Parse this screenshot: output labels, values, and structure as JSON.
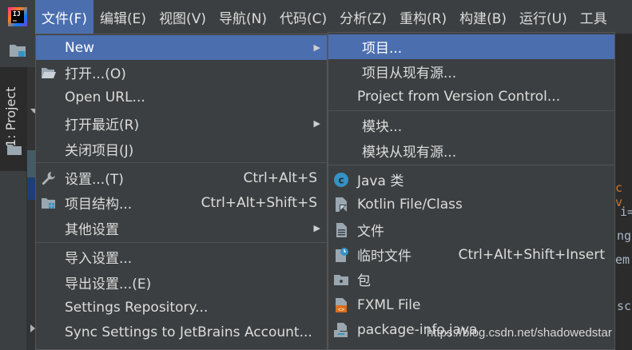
{
  "menubar": {
    "items": [
      {
        "label": "文件(F)",
        "active": true
      },
      {
        "label": "编辑(E)"
      },
      {
        "label": "视图(V)"
      },
      {
        "label": "导航(N)"
      },
      {
        "label": "代码(C)"
      },
      {
        "label": "分析(Z)"
      },
      {
        "label": "重构(R)"
      },
      {
        "label": "构建(B)"
      },
      {
        "label": "运行(U)"
      },
      {
        "label": "工具"
      }
    ]
  },
  "tool_window": {
    "project_label": "1: Project"
  },
  "editor": {
    "fragments": [
      "c v",
      "i=",
      "ng",
      "em.",
      "sc"
    ]
  },
  "file_menu": {
    "items": [
      {
        "label": "New",
        "icon": "none",
        "submenu": true
      },
      {
        "label": "打开...(O)",
        "icon": "folder-open-icon"
      },
      {
        "label": "Open URL..."
      },
      {
        "label": "打开最近(R)",
        "submenu": true
      },
      {
        "label": "关闭项目(J)"
      },
      {
        "label": "设置...(T)",
        "icon": "wrench-icon",
        "shortcut": "Ctrl+Alt+S"
      },
      {
        "label": "项目结构...",
        "icon": "project-structure-icon",
        "shortcut": "Ctrl+Alt+Shift+S"
      },
      {
        "label": "其他设置",
        "submenu": true
      },
      {
        "label": "导入设置..."
      },
      {
        "label": "导出设置...(E)"
      },
      {
        "label": "Settings Repository..."
      },
      {
        "label": "Sync Settings to JetBrains Account..."
      }
    ]
  },
  "new_submenu": {
    "items": [
      {
        "label": "项目..."
      },
      {
        "label": "项目从现有源..."
      },
      {
        "label": "Project from Version Control..."
      },
      {
        "label": "模块..."
      },
      {
        "label": "模块从现有源..."
      },
      {
        "label": "Java 类",
        "icon": "java-class-icon"
      },
      {
        "label": "Kotlin File/Class",
        "icon": "kotlin-file-icon"
      },
      {
        "label": "文件",
        "icon": "file-icon"
      },
      {
        "label": "临时文件",
        "icon": "scratch-file-icon",
        "shortcut": "Ctrl+Alt+Shift+Insert"
      },
      {
        "label": "包",
        "icon": "package-icon"
      },
      {
        "label": "FXML File",
        "icon": "fxml-file-icon"
      },
      {
        "label": "package-info.java",
        "icon": "package-info-icon"
      }
    ]
  },
  "watermark": "https://blog.csdn.net/shadowedstar",
  "colors": {
    "selection": "#4b6eaf",
    "menu_bg": "#3c3f41",
    "editor_bg": "#2b2b2b",
    "java_icon": "#3592c4",
    "fxml_icon": "#d9701f"
  }
}
